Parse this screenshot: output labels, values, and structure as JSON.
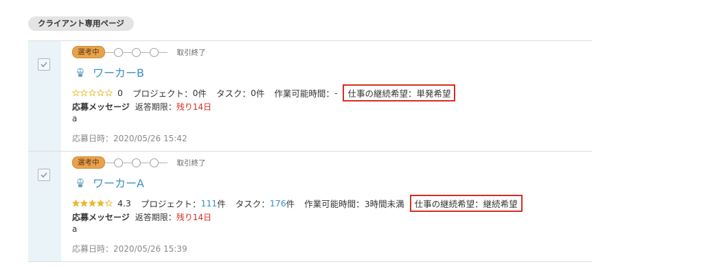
{
  "page_label": "クライアント専用ページ",
  "status_badge": "選考中",
  "status_end": "取引終了",
  "labels": {
    "project": "プロジェクト：",
    "task": "タスク：",
    "available_time": "作業可能時間：",
    "message": "応募メッセージ",
    "deadline": "返答期限：",
    "applied": "応募日時："
  },
  "applicants": [
    {
      "name": "ワーカーB",
      "rating": "0",
      "rating_stars": 0,
      "projects": "0",
      "projects_unit": "件",
      "tasks": "0",
      "tasks_unit": "件",
      "available_time": "-",
      "continuation": "仕事の継続希望：単発希望",
      "deadline": "残り14日",
      "message": "a",
      "applied_at": "2020/05/26 15:42"
    },
    {
      "name": "ワーカーA",
      "rating": "4.3",
      "rating_stars": 4.3,
      "projects": "111",
      "projects_unit": "件",
      "tasks": "176",
      "tasks_unit": "件",
      "available_time": "3時間未満",
      "continuation": "仕事の継続希望：継続希望",
      "deadline": "残り14日",
      "message": "a",
      "applied_at": "2020/05/26 15:39"
    }
  ],
  "colors": {
    "badge": "#e9a24c",
    "link": "#3a8fbf",
    "highlight": "#d62b22",
    "star": "#e8b828"
  }
}
